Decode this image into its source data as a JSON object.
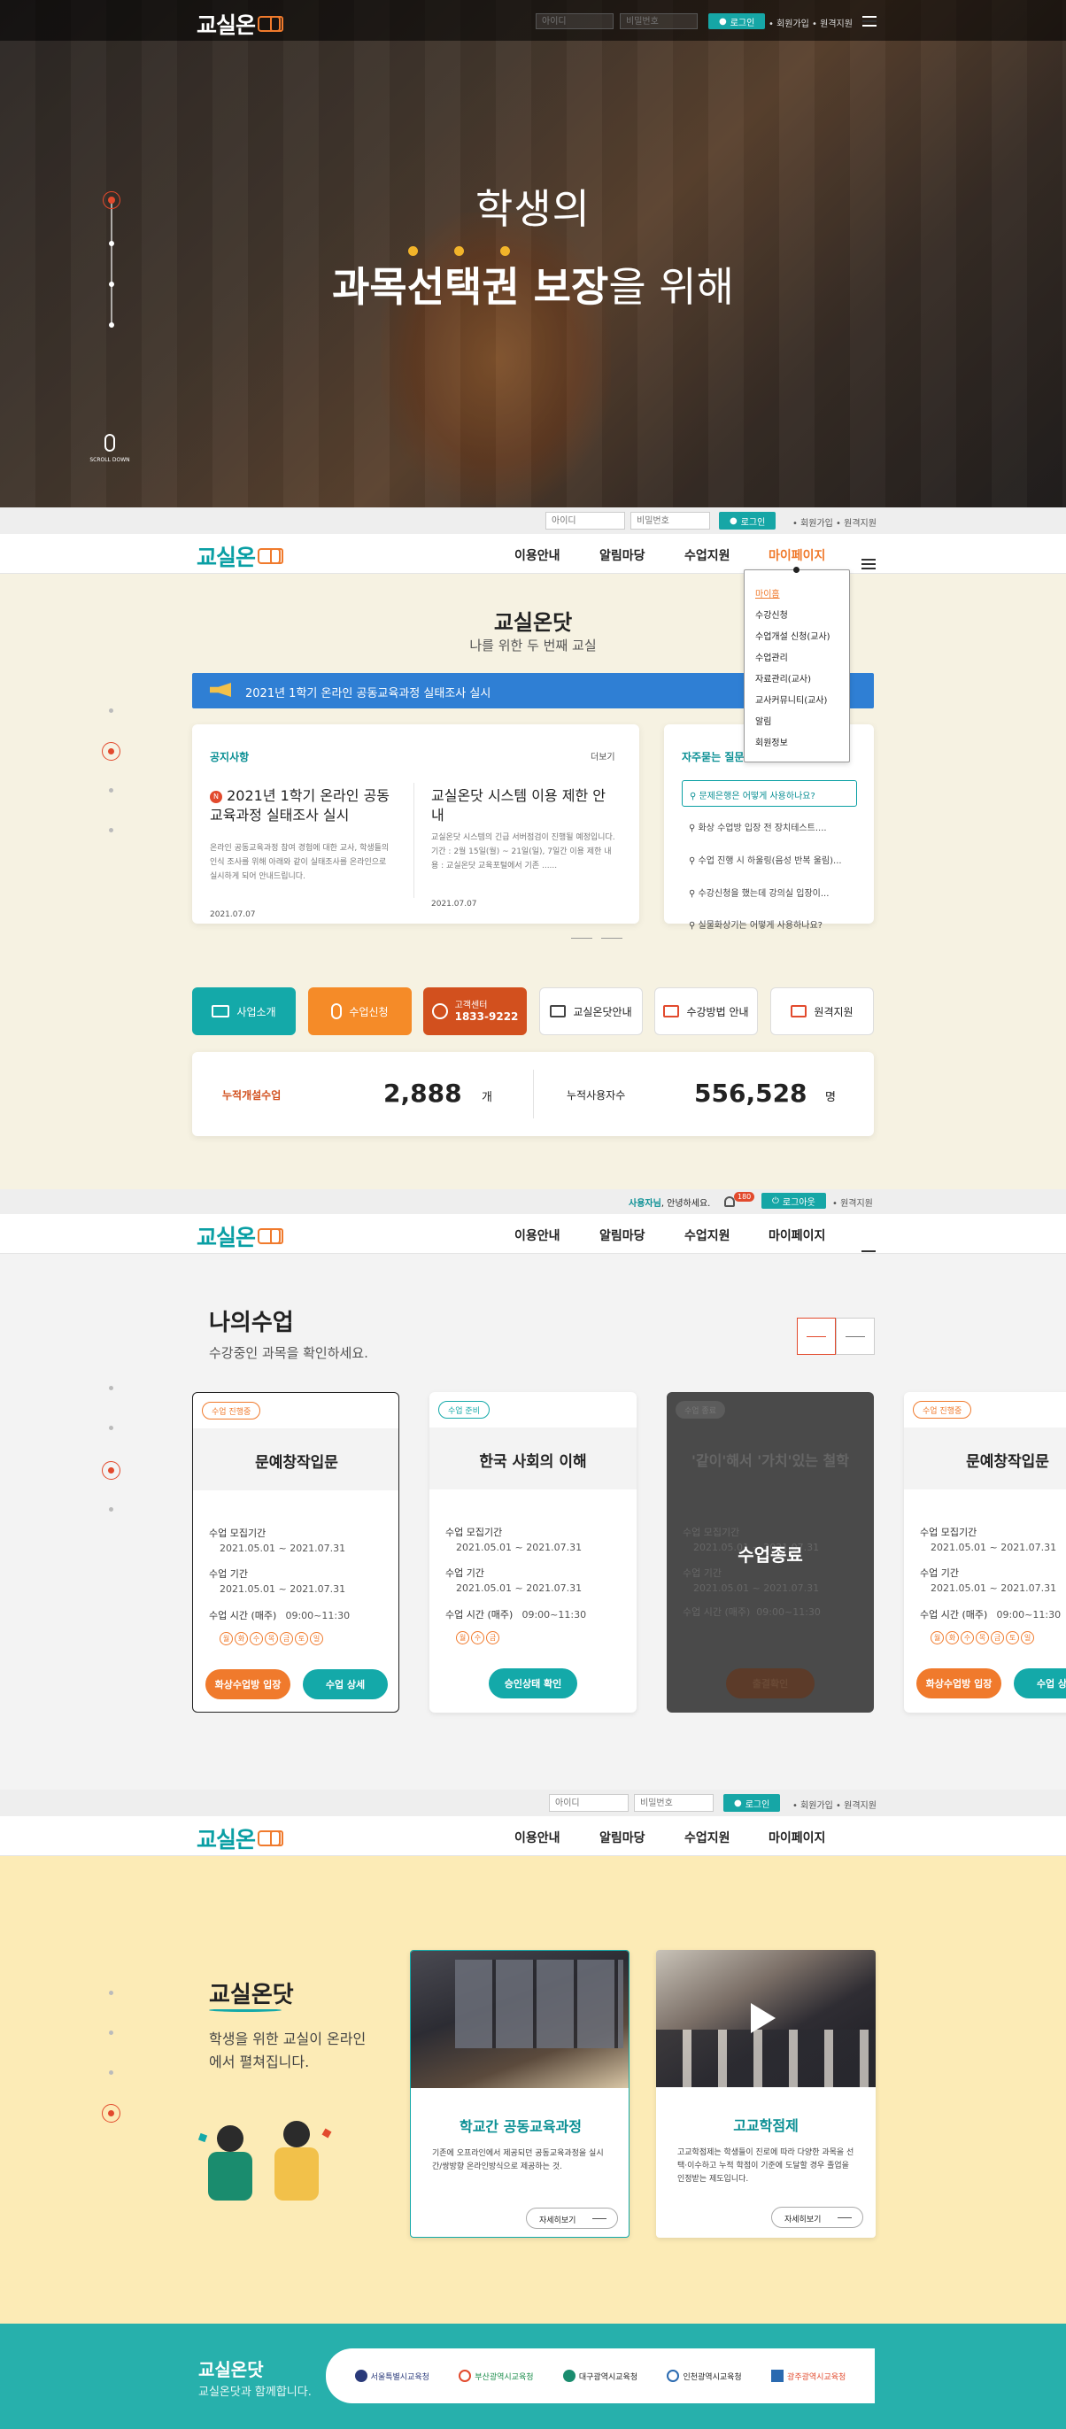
{
  "brand": {
    "logo": "교실온",
    "accent": "#0a9fa4",
    "orange": "#f07a2c",
    "red": "#e24a2d"
  },
  "header1": {
    "id_placeholder": "아이디",
    "pw_placeholder": "비밀번호",
    "login": "로그인",
    "links": "• 회원가입 • 원격지원"
  },
  "hero": {
    "line1": "학생의",
    "line2_a": "과목선택권",
    "line2_b": " 보장",
    "line2_c": "을 위해",
    "scroll": "SCROLL DOWN"
  },
  "header2": {
    "id_placeholder": "아이디",
    "pw_placeholder": "비밀번호",
    "login": "로그인",
    "links": "• 회원가입 • 원격지원"
  },
  "nav": {
    "items": [
      "이용안내",
      "알림마당",
      "수업지원",
      "마이페이지"
    ]
  },
  "dropdown": {
    "items": [
      "마이홈",
      "수강신청",
      "수업개설 신청(교사)",
      "수업관리",
      "자료관리(교사)",
      "교사커뮤니티(교사)",
      "알림",
      "회원정보"
    ]
  },
  "section2": {
    "title": "교실온닷",
    "subtitle": "나를 위한 두 번째 교실",
    "banner": "2021년 1학기 온라인 공동교육과정 실태조사 실시",
    "notice": {
      "title": "공지사항",
      "more": "더보기",
      "items": [
        {
          "badge": "N",
          "title": "2021년 1학기 온라인 공동교육과정 실태조사 실시",
          "body": "온라인 공동교육과정 참여 경험에 대한 교사, 학생들의 인식 조사를 위해 아래와 같이 실태조사를 온라인으로 실시하게 되어 안내드립니다.",
          "date": "2021.07.07"
        },
        {
          "title": "교실온닷 시스템 이용 제한 안내",
          "body": "교실온닷 시스템의 긴급 서버점검이 진행될 예정입니다. 기간 : 2월 15일(월) ~ 21일(일), 7일간 이용 제한 내용 : 교실온닷 교육포털에서 기존 ......",
          "date": "2021.07.07"
        }
      ]
    },
    "faq": {
      "title": "자주묻는 질문",
      "items": [
        "문제은행은 어떻게 사용하나요?",
        "화상 수업방 입장 전 장치테스트....",
        "수업 진행 시 하울링(음성 반복 울림)...",
        "수강신청을 했는데 강의실 입장이...",
        "실물화상기는 어떻게 사용하나요?"
      ]
    },
    "quick": {
      "intro": "사업소개",
      "apply": "수업신청",
      "cs_label": "고객센터",
      "cs_phone": "1833-9222",
      "guide": "교실온닷안내",
      "method": "수강방법 안내",
      "remote": "원격지원"
    },
    "stats": {
      "opened_label": "누적개설수업",
      "opened_value": "2,888",
      "opened_unit": "개",
      "users_label": "누적사용자수",
      "users_value": "556,528",
      "users_unit": "명"
    }
  },
  "header3": {
    "greeting_name": "사용자님",
    "greeting_rest": ", 안녕하세요.",
    "notif_count": "180",
    "logout": "로그아웃",
    "links": "• 원격지원"
  },
  "section3": {
    "title": "나의수업",
    "subtitle": "수강중인 과목을 확인하세요.",
    "cards": [
      {
        "tag": "수업 진행중",
        "title": "문예창작입문",
        "recruit_label": "수업 모집기간",
        "recruit": "2021.05.01 ~ 2021.07.31",
        "period_label": "수업 기간",
        "period": "2021.05.01 ~ 2021.07.31",
        "time_label": "수업 시간 (매주)",
        "time": "09:00~11:30",
        "days": [
          "월",
          "화",
          "수",
          "목",
          "금",
          "토",
          "일"
        ],
        "btn1": "화상수업방 입장",
        "btn2": "수업 상세"
      },
      {
        "tag": "수업 준비",
        "title": "한국 사회의 이해",
        "recruit_label": "수업 모집기간",
        "recruit": "2021.05.01 ~ 2021.07.31",
        "period_label": "수업 기간",
        "period": "2021.05.01 ~ 2021.07.31",
        "time_label": "수업 시간 (매주)",
        "time": "09:00~11:30",
        "days": [
          "월",
          "수",
          "금"
        ],
        "btn1": "승인상태 확인"
      },
      {
        "tag": "수업 종료",
        "title": "'같이'해서 '가치'있는 철학",
        "overlay": "수업종료",
        "recruit_label": "수업 모집기간",
        "recruit": "2021.05.01 ~ 2021.07.31",
        "period_label": "수업 기간",
        "period": "2021.05.01 ~ 2021.07.31",
        "time_label": "수업 시간 (매주)",
        "time": "09:00~11:30",
        "btn1": "출결확인"
      },
      {
        "tag": "수업 진행중",
        "title": "문예창작입문",
        "recruit_label": "수업 모집기간",
        "recruit": "2021.05.01 ~ 2021.07.31",
        "period_label": "수업 기간",
        "period": "2021.05.01 ~ 2021.07.31",
        "time_label": "수업 시간 (매주)",
        "time": "09:00~11:30",
        "days": [
          "월",
          "화",
          "수",
          "목",
          "금",
          "토",
          "일"
        ],
        "btn1": "화상수업방 입장",
        "btn2": "수업 상세"
      }
    ]
  },
  "header4": {
    "id_placeholder": "아이디",
    "pw_placeholder": "비밀번호",
    "login": "로그인",
    "links": "• 회원가입 • 원격지원"
  },
  "section4": {
    "title": "교실온닷",
    "desc": "학생을 위한 교실이 온라인에서 펼쳐집니다.",
    "cards": [
      {
        "title": "학교간 공동교육과정",
        "body": "기존에 오프라인에서 제공되던 공동교육과정을 실시간/쌍방향 온라인방식으로 제공하는 것.",
        "more": "자세히보기"
      },
      {
        "title": "고교학점제",
        "body": "고교학점제는 학생들이 진로에 따라 다양한 과목을 선택·이수하고 누적 학점이 기준에 도달할 경우 졸업을 인정받는 제도입니다.",
        "more": "자세히보기"
      }
    ]
  },
  "footer": {
    "title": "교실온닷",
    "subtitle": "교실온닷과 함께합니다.",
    "partners": [
      "서울특별시교육청",
      "부산광역시교육청",
      "대구광역시교육청",
      "인천광역시교육청",
      "광주광역시교육청"
    ]
  }
}
